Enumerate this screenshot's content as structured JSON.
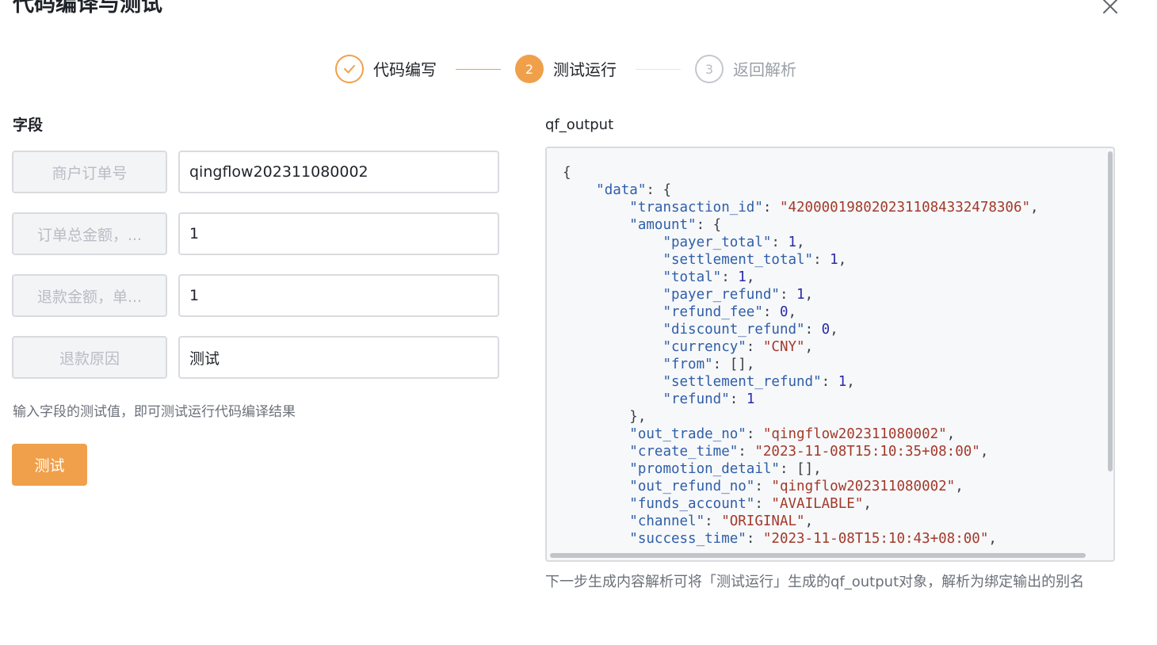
{
  "dialog": {
    "title": "代码编译与测试",
    "close_icon": "close-icon"
  },
  "steps": [
    {
      "label": "代码编写",
      "number": "1",
      "state": "done"
    },
    {
      "label": "测试运行",
      "number": "2",
      "state": "active"
    },
    {
      "label": "返回解析",
      "number": "3",
      "state": "pending"
    }
  ],
  "fields": {
    "section_label": "字段",
    "rows": [
      {
        "name_placeholder": "商户订单号",
        "value": "qingflow202311080002"
      },
      {
        "name_placeholder": "订单总金额，...",
        "value": "1"
      },
      {
        "name_placeholder": "退款金额，单...",
        "value": "1"
      },
      {
        "name_placeholder": "退款原因",
        "value": "测试"
      }
    ],
    "hint": "输入字段的测试值，即可测试运行代码编译结果",
    "test_button": "测试"
  },
  "output": {
    "label": "qf_output",
    "code_lines": [
      {
        "indent": 0,
        "text": "{"
      },
      {
        "indent": 1,
        "key": "data",
        "value": "{",
        "vtype": "p"
      },
      {
        "indent": 2,
        "key": "transaction_id",
        "value": "\"4200001980202311084332478306\"",
        "vtype": "s",
        "trail": ","
      },
      {
        "indent": 2,
        "key": "amount",
        "value": "{",
        "vtype": "p"
      },
      {
        "indent": 3,
        "key": "payer_total",
        "value": "1",
        "vtype": "n",
        "trail": ","
      },
      {
        "indent": 3,
        "key": "settlement_total",
        "value": "1",
        "vtype": "n",
        "trail": ","
      },
      {
        "indent": 3,
        "key": "total",
        "value": "1",
        "vtype": "n",
        "trail": ","
      },
      {
        "indent": 3,
        "key": "payer_refund",
        "value": "1",
        "vtype": "n",
        "trail": ","
      },
      {
        "indent": 3,
        "key": "refund_fee",
        "value": "0",
        "vtype": "n",
        "trail": ","
      },
      {
        "indent": 3,
        "key": "discount_refund",
        "value": "0",
        "vtype": "n",
        "trail": ","
      },
      {
        "indent": 3,
        "key": "currency",
        "value": "\"CNY\"",
        "vtype": "s",
        "trail": ","
      },
      {
        "indent": 3,
        "key": "from",
        "value": "[]",
        "vtype": "p",
        "trail": ","
      },
      {
        "indent": 3,
        "key": "settlement_refund",
        "value": "1",
        "vtype": "n",
        "trail": ","
      },
      {
        "indent": 3,
        "key": "refund",
        "value": "1",
        "vtype": "n"
      },
      {
        "indent": 2,
        "text": "},"
      },
      {
        "indent": 2,
        "key": "out_trade_no",
        "value": "\"qingflow202311080002\"",
        "vtype": "s",
        "trail": ","
      },
      {
        "indent": 2,
        "key": "create_time",
        "value": "\"2023-11-08T15:10:35+08:00\"",
        "vtype": "s",
        "trail": ","
      },
      {
        "indent": 2,
        "key": "promotion_detail",
        "value": "[]",
        "vtype": "p",
        "trail": ","
      },
      {
        "indent": 2,
        "key": "out_refund_no",
        "value": "\"qingflow202311080002\"",
        "vtype": "s",
        "trail": ","
      },
      {
        "indent": 2,
        "key": "funds_account",
        "value": "\"AVAILABLE\"",
        "vtype": "s",
        "trail": ","
      },
      {
        "indent": 2,
        "key": "channel",
        "value": "\"ORIGINAL\"",
        "vtype": "s",
        "trail": ","
      },
      {
        "indent": 2,
        "key": "success_time",
        "value": "\"2023-11-08T15:10:43+08:00\"",
        "vtype": "s",
        "trail": ","
      }
    ],
    "note": "下一步生成内容解析可将「测试运行」生成的qf_output对象，解析为绑定输出的别名"
  },
  "colors": {
    "accent": "#f0a04b",
    "step_pending": "#b8bcc4",
    "json_key": "#2f5ea8",
    "json_string": "#a23a2a",
    "json_number": "#2a2aa8"
  }
}
